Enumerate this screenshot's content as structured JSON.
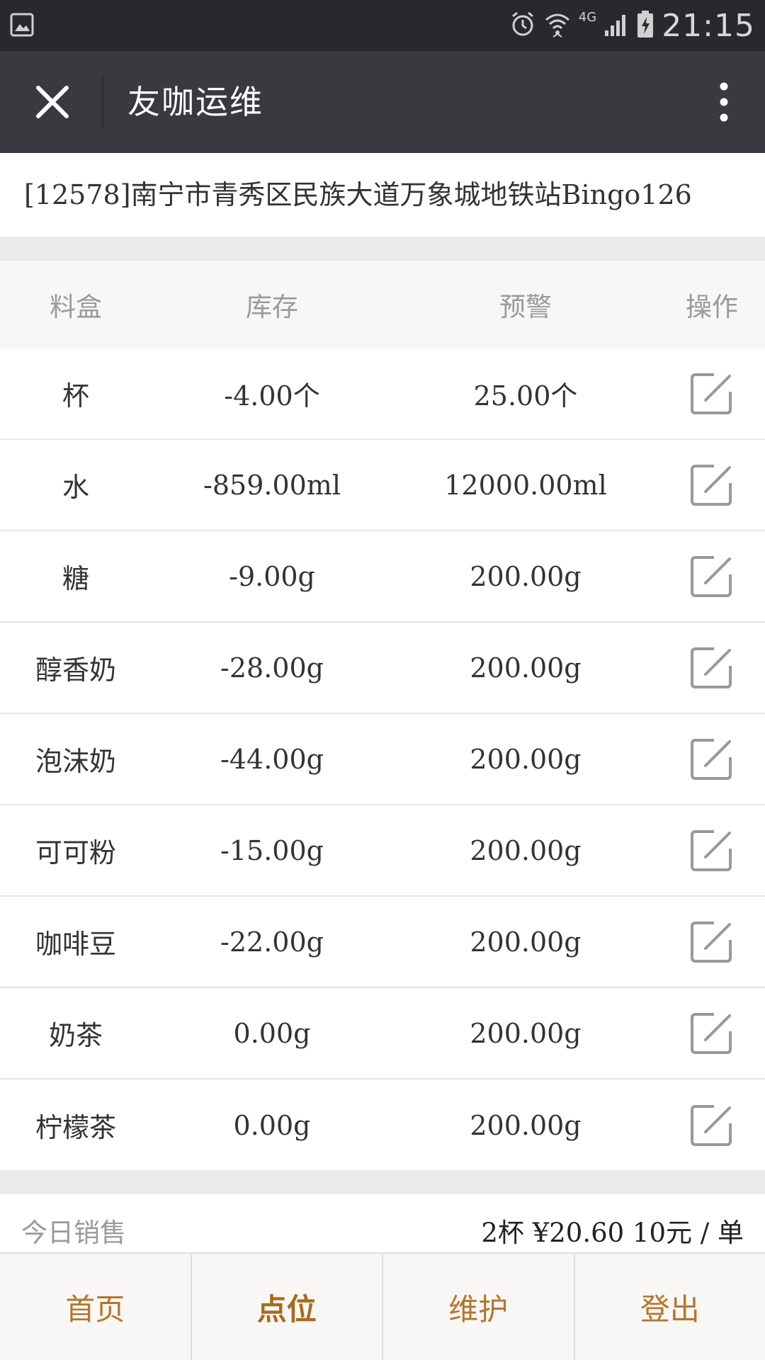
{
  "status_bar": {
    "time": "21:15",
    "network": "4G"
  },
  "title_bar": {
    "title": "友咖运维"
  },
  "location": {
    "text": "[12578]南宁市青秀区民族大道万象城地铁站Bingo126"
  },
  "table": {
    "headers": [
      "料盒",
      "库存",
      "预警",
      "操作"
    ],
    "rows": [
      {
        "name": "杯",
        "stock": "-4.00个",
        "warning": "25.00个"
      },
      {
        "name": "水",
        "stock": "-859.00ml",
        "warning": "12000.00ml"
      },
      {
        "name": "糖",
        "stock": "-9.00g",
        "warning": "200.00g"
      },
      {
        "name": "醇香奶",
        "stock": "-28.00g",
        "warning": "200.00g"
      },
      {
        "name": "泡沫奶",
        "stock": "-44.00g",
        "warning": "200.00g"
      },
      {
        "name": "可可粉",
        "stock": "-15.00g",
        "warning": "200.00g"
      },
      {
        "name": "咖啡豆",
        "stock": "-22.00g",
        "warning": "200.00g"
      },
      {
        "name": "奶茶",
        "stock": "0.00g",
        "warning": "200.00g"
      },
      {
        "name": "柠檬茶",
        "stock": "0.00g",
        "warning": "200.00g"
      }
    ]
  },
  "sales": {
    "label": "今日销售",
    "value": "2杯 ¥20.60 10元 / 单"
  },
  "bottom_nav": {
    "items": [
      {
        "label": "首页"
      },
      {
        "label": "点位"
      },
      {
        "label": "维护"
      },
      {
        "label": "登出"
      }
    ]
  },
  "colors": {
    "status_bar_bg": "#27292c",
    "title_bar_bg": "#393a3f",
    "accent": "#b5762a",
    "header_text": "#9a9a9a"
  }
}
